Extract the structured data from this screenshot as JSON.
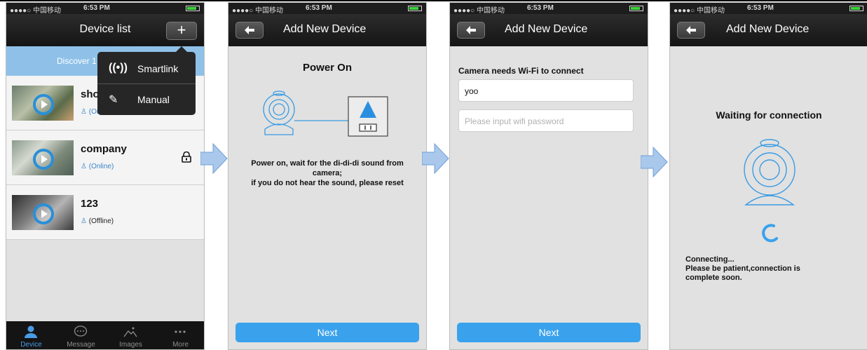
{
  "status": {
    "carrier": "●●●●○ 中国移动 ",
    "time": "6:53 PM"
  },
  "screen1": {
    "title": "Device list",
    "add_label": "+",
    "discover_text": "Discover 1",
    "menu": [
      {
        "icon": "((•))",
        "label": "Smartlink"
      },
      {
        "icon": "✎",
        "label": "Manual"
      }
    ],
    "devices": [
      {
        "name": "sho",
        "status": "(Online)"
      },
      {
        "name": "company",
        "status": "(Online)"
      },
      {
        "name": "123",
        "status": "(Offline)"
      }
    ],
    "tabs": [
      "Device",
      "Message",
      "Images",
      "More"
    ]
  },
  "screen2": {
    "title": "Add New Device",
    "heading": "Power On",
    "instruction_1": "Power on, wait for the di-di-di sound from camera;",
    "instruction_2": "if you do not hear the sound, please reset",
    "next": "Next"
  },
  "screen3": {
    "title": "Add New Device",
    "label": "Camera needs Wi-Fi to connect",
    "ssid_value": "yoo",
    "password_placeholder": "Please input wifi password",
    "next": "Next"
  },
  "screen4": {
    "title": "Add New Device",
    "heading": "Waiting for connection",
    "status_1": "Connecting...",
    "status_2": "Please be patient,connection is",
    "status_3": "complete soon."
  },
  "colors": {
    "accent": "#3aa2ec",
    "navbar": "#1e1e1e",
    "background": "#e1e1e1",
    "arrow": "#a9c8ec"
  }
}
